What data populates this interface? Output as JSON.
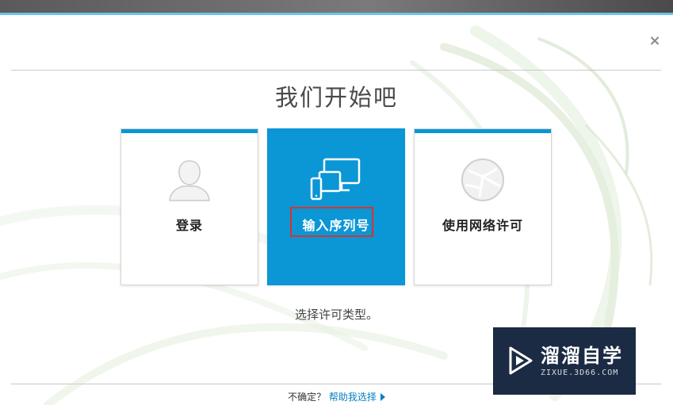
{
  "dialog": {
    "title": "我们开始吧",
    "close_glyph": "×",
    "subtitle": "选择许可类型。"
  },
  "cards": [
    {
      "label": "登录",
      "icon": "user-silhouette-icon",
      "selected": false
    },
    {
      "label": "输入序列号",
      "icon": "devices-icon",
      "selected": true
    },
    {
      "label": "使用网络许可",
      "icon": "globe-network-icon",
      "selected": false
    }
  ],
  "footer": {
    "question": "不确定？",
    "help_link": "帮助我选择"
  },
  "watermark": {
    "title": "溜溜自学",
    "url": "ZIXUE.3D66.COM",
    "icon": "play-logo-icon"
  },
  "colors": {
    "accent": "#0b96d6",
    "highlight": "#d9332c",
    "watermark_bg": "#1b2b43"
  }
}
